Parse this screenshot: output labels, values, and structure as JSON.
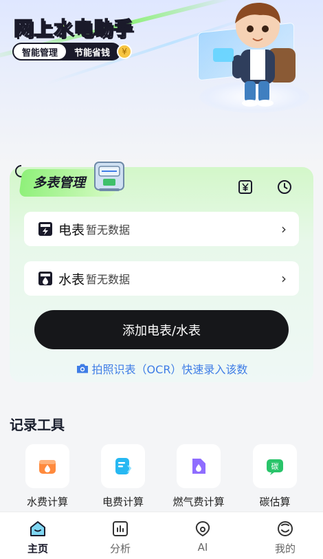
{
  "hero": {
    "title": "网上水电助手",
    "tag_primary": "智能管理",
    "tag_secondary": "节能省钱"
  },
  "meter_card": {
    "title": "多表管理",
    "rows": [
      {
        "name": "电表",
        "status": "暂无数据",
        "icon": "electric-meter-icon"
      },
      {
        "name": "水表",
        "status": "暂无数据",
        "icon": "water-meter-icon"
      }
    ],
    "add_button": "添加电表/水表",
    "ocr_link": "拍照识表（OCR）快速录入该数"
  },
  "tools": {
    "title": "记录工具",
    "items": [
      {
        "label": "水费计算",
        "icon": "water-fee-icon",
        "color": "#ff8a3d"
      },
      {
        "label": "电费计算",
        "icon": "electric-fee-icon",
        "color": "#27b8f2"
      },
      {
        "label": "燃气费计算",
        "icon": "gas-fee-icon",
        "color": "#8f6dff"
      },
      {
        "label": "碳估算",
        "icon": "carbon-icon",
        "color": "#29c46a"
      }
    ],
    "carbon_glyph": "碳"
  },
  "tabbar": {
    "tabs": [
      {
        "label": "主页",
        "icon": "home-icon",
        "active": true
      },
      {
        "label": "分析",
        "icon": "analysis-icon",
        "active": false
      },
      {
        "label": "AI",
        "icon": "ai-icon",
        "active": false
      },
      {
        "label": "我的",
        "icon": "profile-icon",
        "active": false
      }
    ]
  },
  "colors": {
    "accent_green": "#8ff07a",
    "dark": "#16171a",
    "link_blue": "#3f7de6"
  }
}
